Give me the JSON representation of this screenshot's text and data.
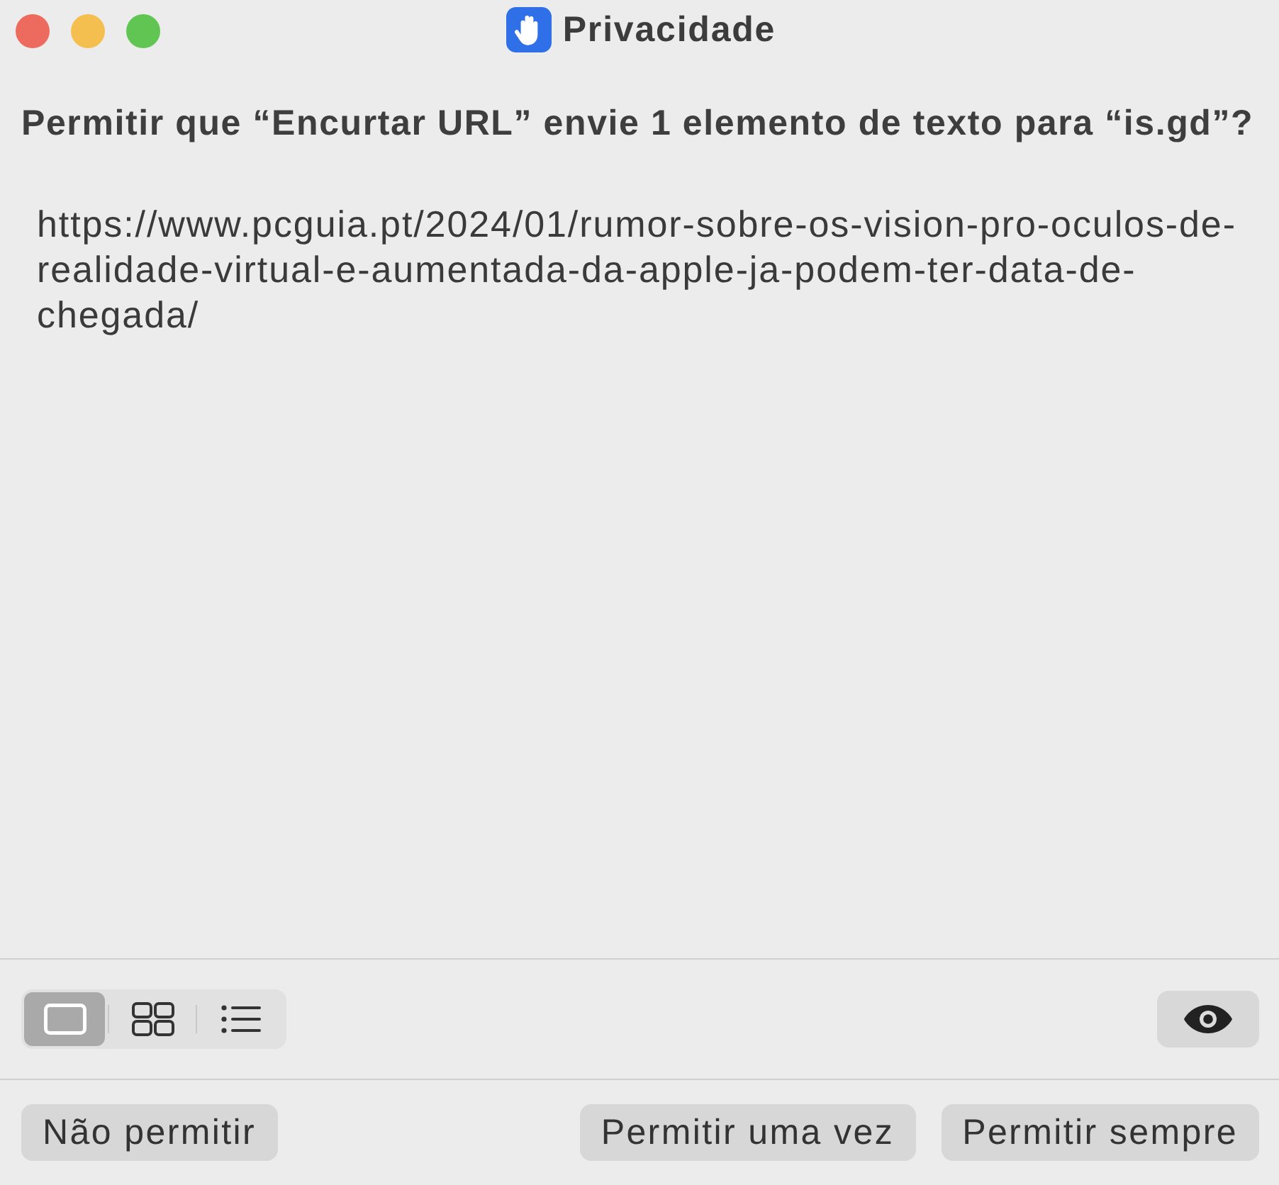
{
  "window": {
    "title": "Privacidade"
  },
  "prompt": "Permitir que “Encurtar URL” envie 1 elemento de texto para “is.gd”?",
  "content": {
    "text": "https://www.pcguia.pt/2024/01/rumor-sobre-os-vision-pro-oculos-de-realidade-virtual-e-aumentada-da-apple-ja-podem-ter-data-de-chegada/"
  },
  "view_switcher": [
    {
      "kind": "single",
      "selected": true
    },
    {
      "kind": "grid",
      "selected": false
    },
    {
      "kind": "list",
      "selected": false
    }
  ],
  "left_buttons": [
    "Não permitir"
  ],
  "right_buttons": [
    "Permitir uma vez",
    "Permitir sempre"
  ]
}
